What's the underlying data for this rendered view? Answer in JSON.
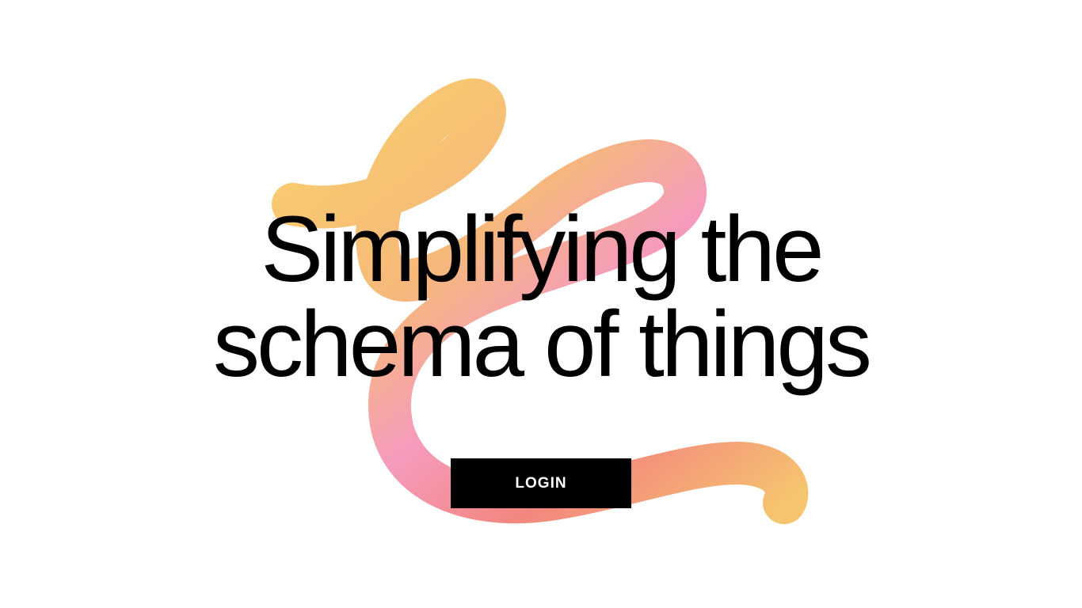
{
  "hero": {
    "title_line_1": "Simplifying the",
    "title_line_2": "schema of things",
    "login_label": "LOGIN"
  },
  "decoration": {
    "icon": "gradient-squiggle-icon",
    "colors": {
      "yellow": "#f6cf6c",
      "pink": "#f59bbd",
      "coral": "#f3867e"
    }
  },
  "colors": {
    "background": "#ffffff",
    "text": "#000000",
    "button_background": "#000000",
    "button_text": "#ffffff"
  }
}
